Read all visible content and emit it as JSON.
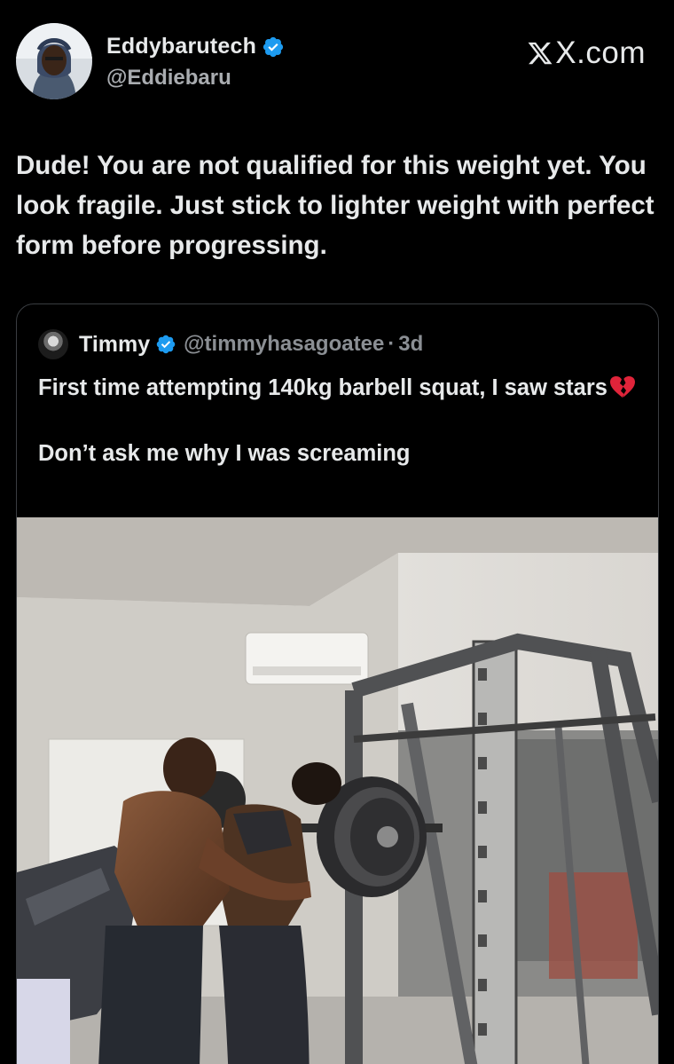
{
  "post": {
    "author_name": "Eddybarutech",
    "author_handle": "@Eddiebaru",
    "brand": "X.com",
    "text": "Dude! You are not qualified for this weight yet. You look fragile.  Just stick to lighter weight with perfect form before progressing."
  },
  "quoted": {
    "author_name": "Timmy",
    "author_handle": "@timmyhasagoatee",
    "separator": "·",
    "time": "3d",
    "line1": "First time attempting 140kg barbell squat, I saw stars",
    "line2": "Don’t ask me why I was screaming"
  },
  "colors": {
    "background": "#000000",
    "text": "#e7e9ea",
    "muted": "#8b8f94",
    "verified": "#1d9bf0",
    "border": "#3a3d41"
  },
  "icons": {
    "verified": "verified-badge-icon",
    "brand": "x-logo-icon",
    "emoji": "broken-heart-emoji"
  }
}
